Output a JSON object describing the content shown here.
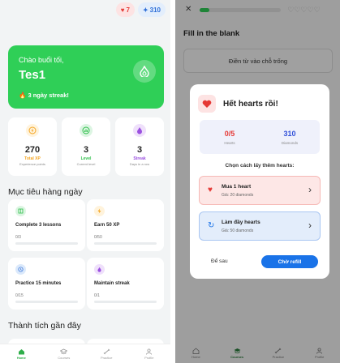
{
  "home": {
    "hearts_count": "7",
    "diamonds_count": "310",
    "greeting": "Chào buổi tối,",
    "username": "Tes1",
    "streak_text": "3 ngày streak!",
    "stats": [
      {
        "value": "270",
        "label": "Total XP",
        "sub": "Experience points",
        "color": "#f5a623"
      },
      {
        "value": "3",
        "label": "Level",
        "sub": "Current level",
        "color": "#2fbf4a"
      },
      {
        "value": "3",
        "label": "Streak",
        "sub": "Days in a row",
        "color": "#9b51e0"
      }
    ],
    "daily_goals_title": "Mục tiêu hàng ngày",
    "goals": [
      {
        "title": "Complete 3 lessons",
        "progress": "0/3",
        "progress_value": 0
      },
      {
        "title": "Earn 50 XP",
        "progress": "0/50",
        "progress_value": 0
      },
      {
        "title": "Practice 15 minutes",
        "progress": "0/15",
        "progress_value": 0
      },
      {
        "title": "Maintain streak",
        "progress": "0/1",
        "progress_value": 0
      }
    ],
    "recent_achievements_title": "Thành tích gần đây",
    "nav": [
      "Home",
      "Courses",
      "Practice",
      "Profile"
    ]
  },
  "exercise": {
    "progress_value": 0.12,
    "heading": "Fill in the blank",
    "prompt_box": "Điền từ vào chỗ trống",
    "nav": [
      "Home",
      "Courses",
      "Practice",
      "Profile"
    ]
  },
  "dialog": {
    "title": "Hết hearts rồi!",
    "hearts_value": "0/5",
    "hearts_label": "Hearts",
    "diamonds_value": "310",
    "diamonds_label": "Diamonds",
    "choose_text": "Chọn cách lấy thêm hearts:",
    "option_buy_title": "Mua 1 heart",
    "option_buy_sub": "Giá: 20 diamonds",
    "option_refill_title": "Làm đầy hearts",
    "option_refill_sub": "Giá: 50 diamonds",
    "later_label": "Để sau",
    "wait_label": "Chờ refill"
  },
  "colors": {
    "brand_green": "#2fcf57",
    "heart_red": "#e53935",
    "diamond_blue": "#2f6fd8",
    "action_blue": "#1a73e8"
  }
}
